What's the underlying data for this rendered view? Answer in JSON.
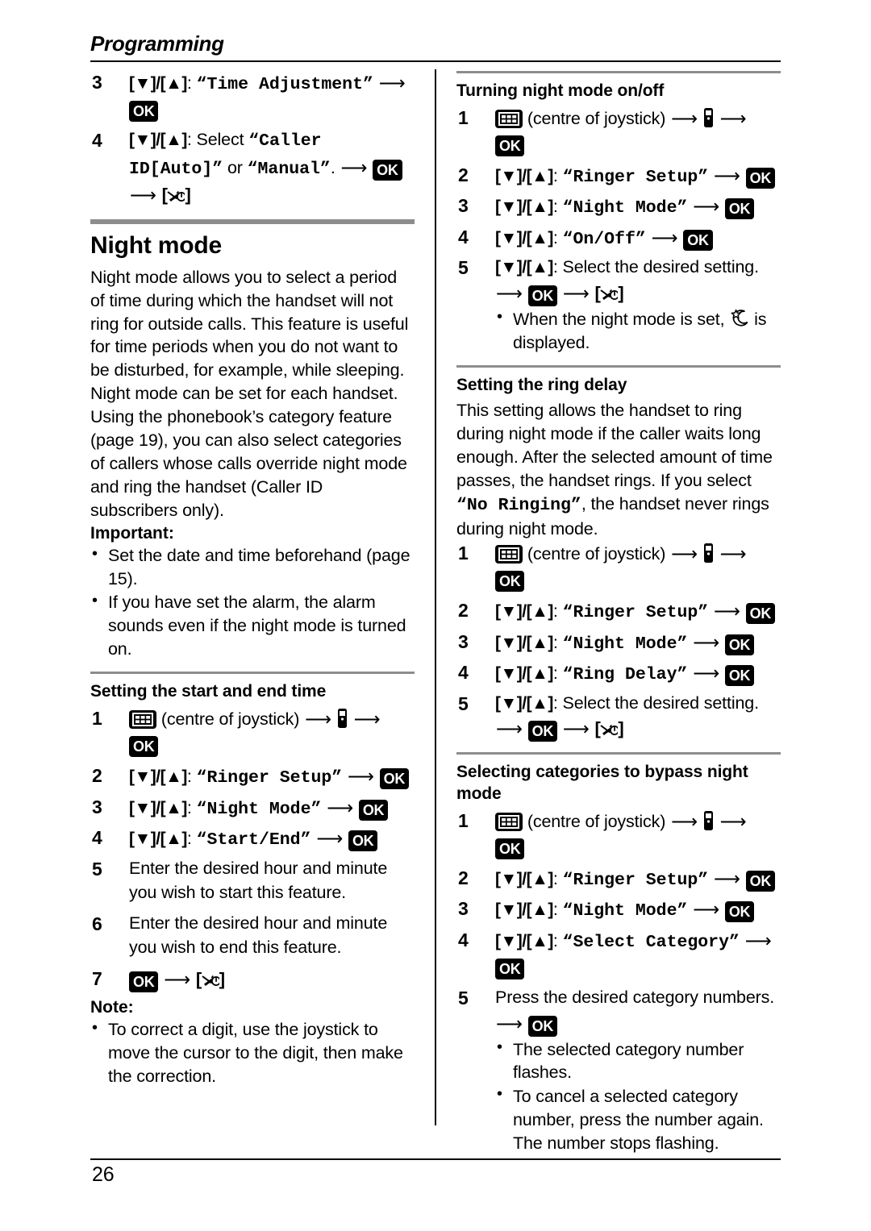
{
  "running_head": "Programming",
  "page_number": "26",
  "icons": {
    "menu": "grid-menu-icon",
    "handset": "handset-icon",
    "off_key": "off-power-key-icon",
    "night_mode": "moon-star-icon",
    "ok_label": "OK"
  },
  "left_column": {
    "continued_steps": [
      {
        "num": "3",
        "keys": "[▼]/[▲]",
        "colon": ":",
        "menu": "“Time Adjustment”",
        "trailing": ""
      },
      {
        "num": "4",
        "keys": "[▼]/[▲]",
        "colon": ":",
        "select_label": "Select",
        "menu_part1": "“Caller ID[Auto]”",
        "or_label": "or",
        "menu_part2": "“Manual”",
        "period": "."
      }
    ],
    "section": {
      "title": "Night mode",
      "paragraphs": [
        "Night mode allows you to select a period of time during which the handset will not ring for outside calls. This feature is useful for time periods when you do not want to be disturbed, for example, while sleeping. Night mode can be set for each handset.",
        "Using the phonebook’s category feature (page 19), you can also select categories of callers whose calls override night mode and ring the handset (Caller ID subscribers only)."
      ],
      "important_label": "Important:",
      "important_items": [
        "Set the date and time beforehand (page 15).",
        "If you have set the alarm, the alarm sounds even if the night mode is turned on."
      ]
    },
    "start_end": {
      "heading": "Setting the start and end time",
      "steps": [
        {
          "num": "1",
          "type": "menu_entry",
          "text": "(centre of joystick)"
        },
        {
          "num": "2",
          "type": "keys",
          "keys": "[▼]/[▲]",
          "menu": "“Ringer Setup”"
        },
        {
          "num": "3",
          "type": "keys",
          "keys": "[▼]/[▲]",
          "menu": "“Night Mode”"
        },
        {
          "num": "4",
          "type": "keys",
          "keys": "[▼]/[▲]",
          "menu": "“Start/End”"
        },
        {
          "num": "5",
          "type": "plain",
          "text": "Enter the desired hour and minute you wish to start this feature."
        },
        {
          "num": "6",
          "type": "plain",
          "text": "Enter the desired hour and minute you wish to end this feature."
        },
        {
          "num": "7",
          "type": "ok_off"
        }
      ],
      "note_label": "Note:",
      "note_items": [
        "To correct a digit, use the joystick to move the cursor to the digit, then make the correction."
      ]
    }
  },
  "right_column": {
    "on_off": {
      "heading": "Turning night mode on/off",
      "steps": [
        {
          "num": "1",
          "type": "menu_entry",
          "text": "(centre of joystick)"
        },
        {
          "num": "2",
          "type": "keys",
          "keys": "[▼]/[▲]",
          "menu": "“Ringer Setup”"
        },
        {
          "num": "3",
          "type": "keys",
          "keys": "[▼]/[▲]",
          "menu": "“Night Mode”"
        },
        {
          "num": "4",
          "type": "keys",
          "keys": "[▼]/[▲]",
          "menu": "“On/Off”"
        },
        {
          "num": "5",
          "type": "select_setting",
          "keys": "[▼]/[▲]",
          "text": "Select the desired setting."
        }
      ],
      "bullet_prefix": "When the night mode is set,",
      "bullet_suffix": "is displayed."
    },
    "ring_delay": {
      "heading": "Setting the ring delay",
      "paragraph_part1": "This setting allows the handset to ring during night mode if the caller waits long enough. After the selected amount of time passes, the handset rings. If you select",
      "paragraph_menu": "“No Ringing”",
      "paragraph_part2": ", the handset never rings during night mode.",
      "steps": [
        {
          "num": "1",
          "type": "menu_entry",
          "text": "(centre of joystick)"
        },
        {
          "num": "2",
          "type": "keys",
          "keys": "[▼]/[▲]",
          "menu": "“Ringer Setup”"
        },
        {
          "num": "3",
          "type": "keys",
          "keys": "[▼]/[▲]",
          "menu": "“Night Mode”"
        },
        {
          "num": "4",
          "type": "keys",
          "keys": "[▼]/[▲]",
          "menu": "“Ring Delay”"
        },
        {
          "num": "5",
          "type": "select_setting",
          "keys": "[▼]/[▲]",
          "text": "Select the desired setting."
        }
      ]
    },
    "bypass": {
      "heading": "Selecting categories to bypass night mode",
      "steps": [
        {
          "num": "1",
          "type": "menu_entry",
          "text": "(centre of joystick)"
        },
        {
          "num": "2",
          "type": "keys",
          "keys": "[▼]/[▲]",
          "menu": "“Ringer Setup”"
        },
        {
          "num": "3",
          "type": "keys",
          "keys": "[▼]/[▲]",
          "menu": "“Night Mode”"
        },
        {
          "num": "4",
          "type": "keys",
          "keys": "[▼]/[▲]",
          "menu": "“Select Category”"
        },
        {
          "num": "5",
          "type": "press_numbers",
          "text": "Press the desired category numbers."
        }
      ],
      "substeps": [
        "The selected category number flashes.",
        "To cancel a selected category number, press the number again. The number stops flashing."
      ]
    }
  }
}
